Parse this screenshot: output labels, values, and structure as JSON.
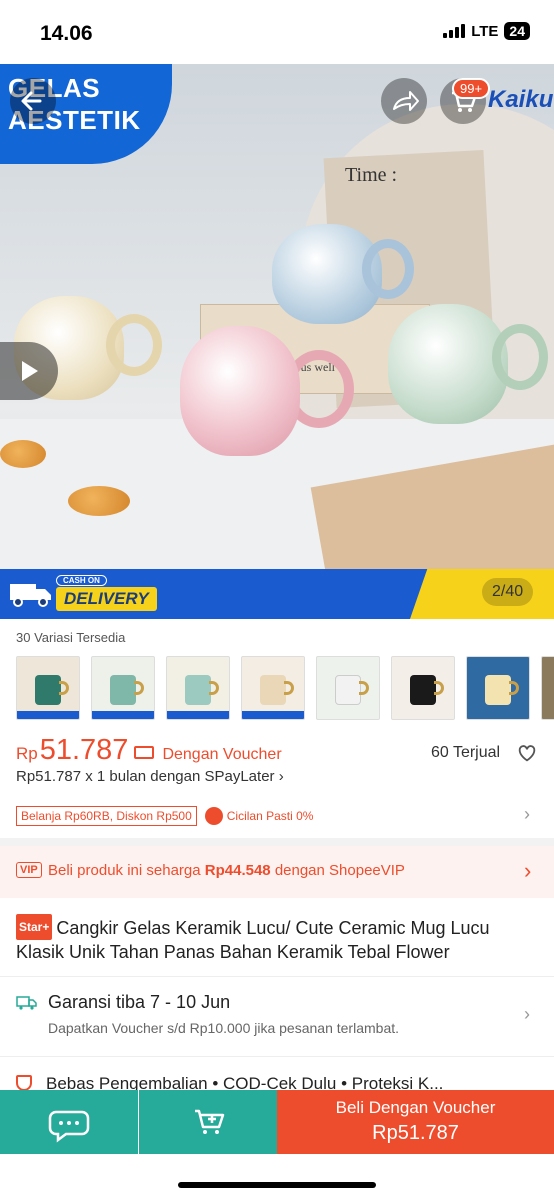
{
  "status": {
    "time": "14.06",
    "network": "LTE",
    "battery": "24"
  },
  "hero": {
    "badge_line1": "GELAS",
    "badge_line2": "AESTETIK",
    "board_text": "Time :",
    "box_text": "Gus  well",
    "cart_count": "99+",
    "brand": "Kaiku",
    "cod_label": "CASH ON",
    "delivery_label": "DELIVERY",
    "image_counter": "2/40",
    "icons": [
      "back-arrow-icon",
      "share-icon",
      "cart-icon",
      "play-icon",
      "truck-icon"
    ]
  },
  "variants": {
    "label": "30 Variasi Tersedia",
    "thumbs": [
      {
        "cup": "#2f7a6a"
      },
      {
        "cup": "#7fb8a8"
      },
      {
        "cup": "#9cc9c0"
      },
      {
        "cup": "#e9d7b8"
      },
      {
        "cup": "#f2f2f2"
      },
      {
        "cup": "#1a1a1a"
      },
      {
        "cup": "#f3e3b0"
      },
      {
        "cup": "#b59c7a"
      }
    ]
  },
  "price": {
    "currency": "Rp",
    "value": "51.787",
    "voucher_text": "Dengan Voucher",
    "sold": "60 Terjual",
    "spaylater": "Rp51.787 x 1 bulan dengan SPayLater",
    "promo_discount": "Belanja Rp60RB, Diskon Rp500",
    "promo_installment": "Cicilan Pasti 0%"
  },
  "vip": {
    "badge": "VIP",
    "text_before": "Beli produk ini seharga",
    "amount": "Rp44.548",
    "text_after": "dengan ShopeeVIP"
  },
  "product": {
    "tag": "Star+",
    "title": "Cangkir Gelas Keramik Lucu/ Cute Ceramic Mug Lucu Klasik Unik Tahan Panas Bahan Keramik Tebal Flower"
  },
  "guarantee": {
    "title": "Garansi tiba 7 - 10 Jun",
    "subtitle": "Dapatkan Voucher s/d Rp10.000 jika pesanan terlambat."
  },
  "returns": {
    "text": "Bebas Pengembalian  •  COD-Cek Dulu  •  Proteksi K..."
  },
  "bottom_bar": {
    "buy_label": "Beli Dengan Voucher",
    "buy_price": "Rp51.787"
  },
  "colors": {
    "accent": "#ee4d2d",
    "teal": "#26aa99",
    "brand_blue": "#1a5ccf",
    "delivery_yellow": "#f7d21b"
  }
}
